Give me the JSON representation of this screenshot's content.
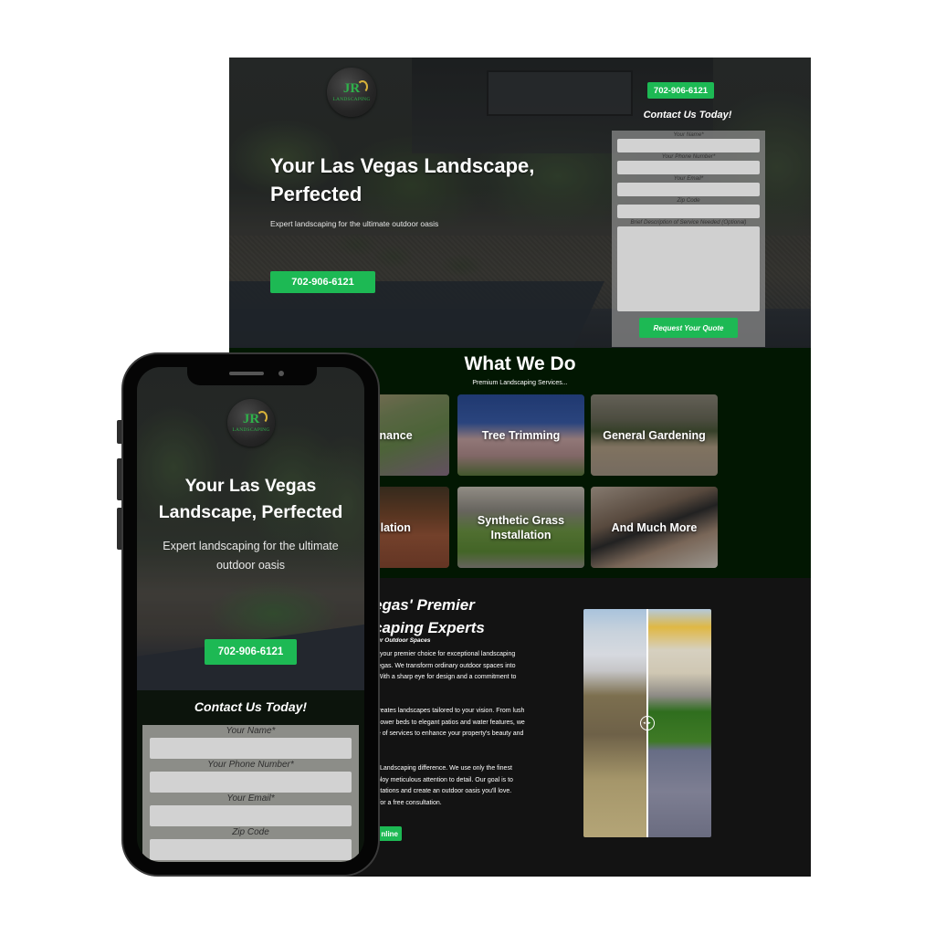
{
  "brand": {
    "logo_initials": "JR",
    "logo_wordmark": "LANDSCAPING",
    "accent_color": "#1db954",
    "services_bg_color": "#021702",
    "about_bg_color": "#131313"
  },
  "desktop": {
    "header_phone_button": "702-906-6121",
    "hero": {
      "title": "Your Las Vegas Landscape, Perfected",
      "subtitle": "Expert landscaping for the ultimate outdoor oasis",
      "call_button": "702-906-6121"
    },
    "contact_form": {
      "title": "Contact Us Today!",
      "fields": [
        {
          "label": "Your Name*",
          "value": ""
        },
        {
          "label": "Your Phone Number*",
          "value": ""
        },
        {
          "label": "Your Email*",
          "value": ""
        },
        {
          "label": "Zip Code",
          "value": ""
        }
      ],
      "description_label": "Brief Description of Service Needed (Optional)",
      "description_value": "",
      "submit_label": "Request Your Quote"
    },
    "services": {
      "title": "What We Do",
      "subtitle": "Premium Landscaping Services...",
      "tiles": [
        {
          "label": "intenance"
        },
        {
          "label": "Tree Trimming"
        },
        {
          "label": "General Gardening"
        },
        {
          "label": "stallation"
        },
        {
          "label": "Synthetic Grass Installation"
        },
        {
          "label": "And Much More"
        }
      ]
    },
    "about": {
      "heading": "egas' Premier\ncaping Experts",
      "kicker": "our Outdoor Spaces",
      "paragraphs": [
        "is your premier choice for exceptional landscaping\nVegas. We transform ordinary outdoor spaces into\n. With a sharp eye for design and a commitment to",
        " creates landscapes tailored to your vision. From lush\nt flower beds to elegant patios and water features, we\nge of services to enhance your property's beauty and",
        "R Landscaping difference. We use only the finest\nnploy meticulous attention to detail. Our goal is to\nectations and create an outdoor oasis you'll love.\ny for a free consultation."
      ],
      "cta_label": "nline",
      "before_after_handle": "◂ ▸"
    }
  },
  "mobile": {
    "hero": {
      "title": "Your Las Vegas\nLandscape, Perfected",
      "subtitle": "Expert landscaping for the ultimate\noutdoor oasis",
      "call_button": "702-906-6121"
    },
    "contact_form": {
      "title": "Contact Us Today!",
      "fields": [
        {
          "label": "Your Name*",
          "value": ""
        },
        {
          "label": "Your Phone Number*",
          "value": ""
        },
        {
          "label": "Your Email*",
          "value": ""
        },
        {
          "label": "Zip Code",
          "value": ""
        }
      ]
    }
  }
}
